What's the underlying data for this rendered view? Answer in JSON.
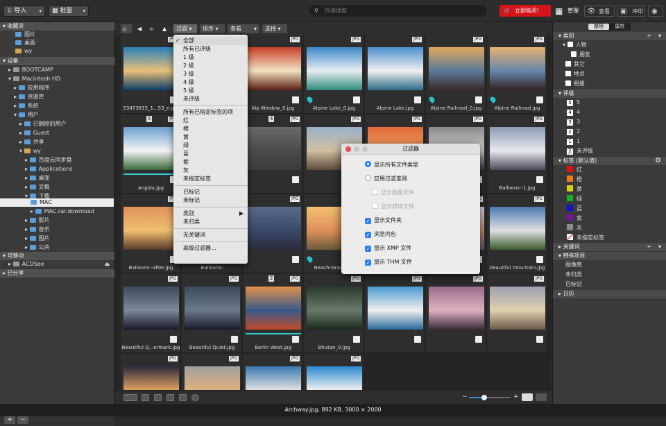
{
  "topbar": {
    "import_label": "导入",
    "batch_label": "批量",
    "search_placeholder": "快速搜索",
    "buy_label": "立即购买!",
    "modes": [
      "管理",
      "查看",
      "冲印"
    ]
  },
  "left": {
    "favorites_header": "收藏夹",
    "favorites": [
      "图片",
      "桌面",
      "wy"
    ],
    "devices_header": "设备",
    "devices": [
      {
        "label": "BOOTCAMP"
      },
      {
        "label": "Macintosh HD"
      },
      {
        "label": "应用程序"
      },
      {
        "label": "资源库"
      },
      {
        "label": "系统"
      },
      {
        "label": "用户"
      },
      {
        "label": "已删除的用户"
      },
      {
        "label": "Guest"
      },
      {
        "label": "共享"
      },
      {
        "label": "wy"
      },
      {
        "label": "百度云同步盘"
      },
      {
        "label": "Applications"
      },
      {
        "label": "桌面"
      },
      {
        "label": "文稿"
      },
      {
        "label": "下载"
      },
      {
        "label": "MAC"
      },
      {
        "label": "MAC.rar.download"
      },
      {
        "label": "影片"
      },
      {
        "label": "音乐"
      },
      {
        "label": "图片"
      },
      {
        "label": "公共"
      }
    ],
    "removable_header": "可移动",
    "removable": [
      "ACDSee"
    ],
    "shared_header": "已分享",
    "add_label": "+",
    "remove_label": "−"
  },
  "center_toolbar": {
    "filter_label": "过滤",
    "sort_label": "排序",
    "view_label": "查看",
    "select_label": "选择"
  },
  "grid": {
    "badge": "JPG",
    "items": [
      {
        "name": "53473815_1...53_n.jpg",
        "num": "",
        "pin": false,
        "bar": false,
        "colors": [
          "#2a80b9",
          "#e8c07a",
          "#0d3c66"
        ]
      },
      {
        "name": "air balloons.jpg",
        "num": "",
        "pin": false,
        "bar": false,
        "colors": [
          "#4ca3e0",
          "#e86b4a",
          "#8ac2e8"
        ]
      },
      {
        "name": "Alp Window_0.jpg",
        "num": "",
        "pin": false,
        "bar": false,
        "colors": [
          "#c8402a",
          "#f2e2c0",
          "#5a1d12"
        ]
      },
      {
        "name": "Alpine Lake_0.jpg",
        "num": "",
        "pin": true,
        "bar": false,
        "colors": [
          "#3c87c8",
          "#e7eef2",
          "#2f8a7a"
        ]
      },
      {
        "name": "Alpine Lake.jpg",
        "num": "",
        "pin": false,
        "bar": false,
        "colors": [
          "#4b8fcf",
          "#f0f0f0",
          "#2a6a84"
        ]
      },
      {
        "name": "Alpine Railroad_0.jpg",
        "num": "",
        "pin": true,
        "bar": false,
        "colors": [
          "#e0a85a",
          "#5a7a9a",
          "#3a2a2a"
        ]
      },
      {
        "name": "Alpine Railroad.jpg",
        "num": "",
        "pin": true,
        "bar": false,
        "colors": [
          "#e8b070",
          "#6688aa",
          "#332222"
        ]
      },
      {
        "name": "Angola.jpg",
        "num": "5",
        "pin": false,
        "bar": true,
        "colors": [
          "#6aa0cf",
          "#f4f4f4",
          "#3a6a3a"
        ]
      },
      {
        "name": "Archway.jpg",
        "num": "",
        "pin": false,
        "bar": false,
        "colors": [
          "#5a7a9a",
          "#2a2a3a",
          "#7a8aa0"
        ]
      },
      {
        "name": "",
        "num": "4",
        "pin": false,
        "bar": false,
        "colors": [
          "#6a6a6a",
          "#4a4a4a",
          "#3a3a3a"
        ]
      },
      {
        "name": "",
        "num": "",
        "pin": false,
        "bar": false,
        "colors": [
          "#9ab0c8",
          "#d0c0a0",
          "#5a4a3a"
        ]
      },
      {
        "name": "Badlands.jpg",
        "num": "",
        "pin": false,
        "bar": false,
        "colors": [
          "#e06a3a",
          "#f0a060",
          "#7a2a1a"
        ]
      },
      {
        "name": "Balloons--6.jpg",
        "num": "",
        "pin": true,
        "bar": false,
        "colors": [
          "#8a8a8a",
          "#d0d0d0",
          "#3a3a3a"
        ]
      },
      {
        "name": "Balloons--1.jpg",
        "num": "",
        "pin": false,
        "bar": false,
        "colors": [
          "#8a9ab0",
          "#e8e8f0",
          "#4a4a5a"
        ]
      },
      {
        "name": "Balloons--after.jpg",
        "num": "",
        "pin": false,
        "bar": false,
        "colors": [
          "#e0905a",
          "#f0c070",
          "#5a3a2a"
        ]
      },
      {
        "name": "Balloons-",
        "num": "",
        "pin": false,
        "bar": false,
        "colors": [
          "#e07a4a",
          "#f0b060",
          "#3a3a5a"
        ]
      },
      {
        "name": "",
        "num": "",
        "pin": false,
        "bar": false,
        "colors": [
          "#5a6a8a",
          "#3a4a6a",
          "#2a2a3a"
        ]
      },
      {
        "name": "Beach-Grass.jpg",
        "num": "",
        "pin": true,
        "bar": false,
        "colors": [
          "#f0c070",
          "#e0905a",
          "#6a5a3a"
        ]
      },
      {
        "name": "beach.jpg",
        "num": "5",
        "pin": false,
        "bar": true,
        "colors": [
          "#e07a3a",
          "#3a7ab0",
          "#f0c070"
        ]
      },
      {
        "name": "Beautiful City.jpg",
        "num": "",
        "pin": false,
        "bar": false,
        "colors": [
          "#e0e0f0",
          "#c89070",
          "#5a5a6a"
        ]
      },
      {
        "name": "beautiful mountain.jpg",
        "num": "",
        "pin": false,
        "bar": false,
        "colors": [
          "#4a7ab0",
          "#e0e0e0",
          "#3a5a2a"
        ]
      },
      {
        "name": "Beautiful Q...ermark.jpg",
        "num": "",
        "pin": false,
        "bar": false,
        "colors": [
          "#3a4a5a",
          "#7a8a9a",
          "#1a1a2a"
        ]
      },
      {
        "name": "Beautiful Quiet.jpg",
        "num": "",
        "pin": false,
        "bar": false,
        "colors": [
          "#3a4a5a",
          "#6a7a8a",
          "#1a1a2a"
        ]
      },
      {
        "name": "Berlin West.jpg",
        "num": "2",
        "pin": false,
        "bar": true,
        "colors": [
          "#e0904a",
          "#3a5a8a",
          "#c04a2a"
        ]
      },
      {
        "name": "Bhutan_0.jpg",
        "num": "",
        "pin": false,
        "bar": false,
        "colors": [
          "#2a3a2a",
          "#6a7a6a",
          "#1a2a1a"
        ]
      },
      {
        "name": "",
        "num": "",
        "pin": false,
        "bar": false,
        "colors": [
          "#4a9ad0",
          "#f0f0f0",
          "#2a6a9a"
        ]
      },
      {
        "name": "",
        "num": "",
        "pin": false,
        "bar": false,
        "colors": [
          "#9a6a8a",
          "#e0b0c0",
          "#3a2a3a"
        ]
      },
      {
        "name": "",
        "num": "",
        "pin": false,
        "bar": false,
        "colors": [
          "#a0a0b0",
          "#e0d0b0",
          "#6a5a4a"
        ]
      },
      {
        "name": "",
        "num": "",
        "pin": false,
        "bar": false,
        "colors": [
          "#2a2a3a",
          "#e0a060",
          "#5a3a2a"
        ]
      },
      {
        "name": "",
        "num": "",
        "pin": false,
        "bar": false,
        "colors": [
          "#a0a0a0",
          "#e0b080",
          "#3a2a2a"
        ]
      },
      {
        "name": "",
        "num": "",
        "pin": false,
        "bar": false,
        "colors": [
          "#3a7ab0",
          "#e0e0e0",
          "#2a4a6a"
        ]
      },
      {
        "name": "",
        "num": "",
        "pin": false,
        "bar": false,
        "colors": [
          "#2a8ad0",
          "#f0f0f0",
          "#1a5a8a"
        ]
      }
    ]
  },
  "menu": {
    "items": [
      {
        "label": "全部",
        "checked": true,
        "sep_after": false
      },
      {
        "label": "所有已评级",
        "checked": false,
        "sep_after": false
      },
      {
        "label": "1 级",
        "checked": false,
        "sep_after": false
      },
      {
        "label": "2 级",
        "checked": false,
        "sep_after": false
      },
      {
        "label": "3 级",
        "checked": false,
        "sep_after": false
      },
      {
        "label": "4 级",
        "checked": false,
        "sep_after": false
      },
      {
        "label": "5 级",
        "checked": false,
        "sep_after": false
      },
      {
        "label": "未评级",
        "checked": false,
        "sep_after": true
      },
      {
        "label": "所有已指定标签的项",
        "checked": false,
        "sep_after": false
      },
      {
        "label": "红",
        "checked": false,
        "sep_after": false
      },
      {
        "label": "橙",
        "checked": false,
        "sep_after": false
      },
      {
        "label": "黄",
        "checked": false,
        "sep_after": false
      },
      {
        "label": "绿",
        "checked": false,
        "sep_after": false
      },
      {
        "label": "蓝",
        "checked": false,
        "sep_after": false
      },
      {
        "label": "紫",
        "checked": false,
        "sep_after": false
      },
      {
        "label": "灰",
        "checked": false,
        "sep_after": false
      },
      {
        "label": "未指定标签",
        "checked": false,
        "sep_after": true
      },
      {
        "label": "已标记",
        "checked": false,
        "sep_after": false
      },
      {
        "label": "未标记",
        "checked": false,
        "sep_after": true
      },
      {
        "label": "类别",
        "checked": false,
        "sep_after": false,
        "submenu": true
      },
      {
        "label": "未归类",
        "checked": false,
        "sep_after": true
      },
      {
        "label": "无关键词",
        "checked": false,
        "sep_after": true
      },
      {
        "label": "高级过滤器...",
        "checked": false,
        "sep_after": false
      }
    ]
  },
  "dialog": {
    "title": "过滤器",
    "show_all": "显示所有文件类型",
    "apply_filter": "应用过滤准则",
    "show_images": "显示图像文件",
    "show_media": "显示媒体文件",
    "show_folders": "显示文件夹",
    "browse_packages": "浏览内包",
    "show_xmp": "显示 XMP 文件",
    "show_thm": "显示 THM 文件"
  },
  "right": {
    "tabs": [
      "整理",
      "属性"
    ],
    "category_header": "类别",
    "categories": [
      "人物",
      "朋友",
      "其它",
      "地点",
      "相册"
    ],
    "rating_header": "评级",
    "ratings": [
      {
        "num": "5",
        "label": "5"
      },
      {
        "num": "4",
        "label": "4"
      },
      {
        "num": "3",
        "label": "3"
      },
      {
        "num": "2",
        "label": "2"
      },
      {
        "num": "1",
        "label": "1"
      },
      {
        "num": "",
        "label": "未评级"
      }
    ],
    "labels_header": "标签 (默认值)",
    "labels": [
      {
        "label": "红",
        "color": "#e01010"
      },
      {
        "label": "橙",
        "color": "#f07a10"
      },
      {
        "label": "黄",
        "color": "#d8d010"
      },
      {
        "label": "绿",
        "color": "#10b020"
      },
      {
        "label": "蓝",
        "color": "#1010d0"
      },
      {
        "label": "紫",
        "color": "#7a10a0"
      },
      {
        "label": "灰",
        "color": "#8a8a8a"
      },
      {
        "label": "未指定标签",
        "color": "#ffffff"
      }
    ],
    "keywords_header": "关键词",
    "special_header": "特殊项目",
    "special": [
      "图像库",
      "未归类",
      "已标记"
    ],
    "calendar_header": "日历"
  },
  "status": "Archway.jpg, 892 KB, 3000 × 2000"
}
